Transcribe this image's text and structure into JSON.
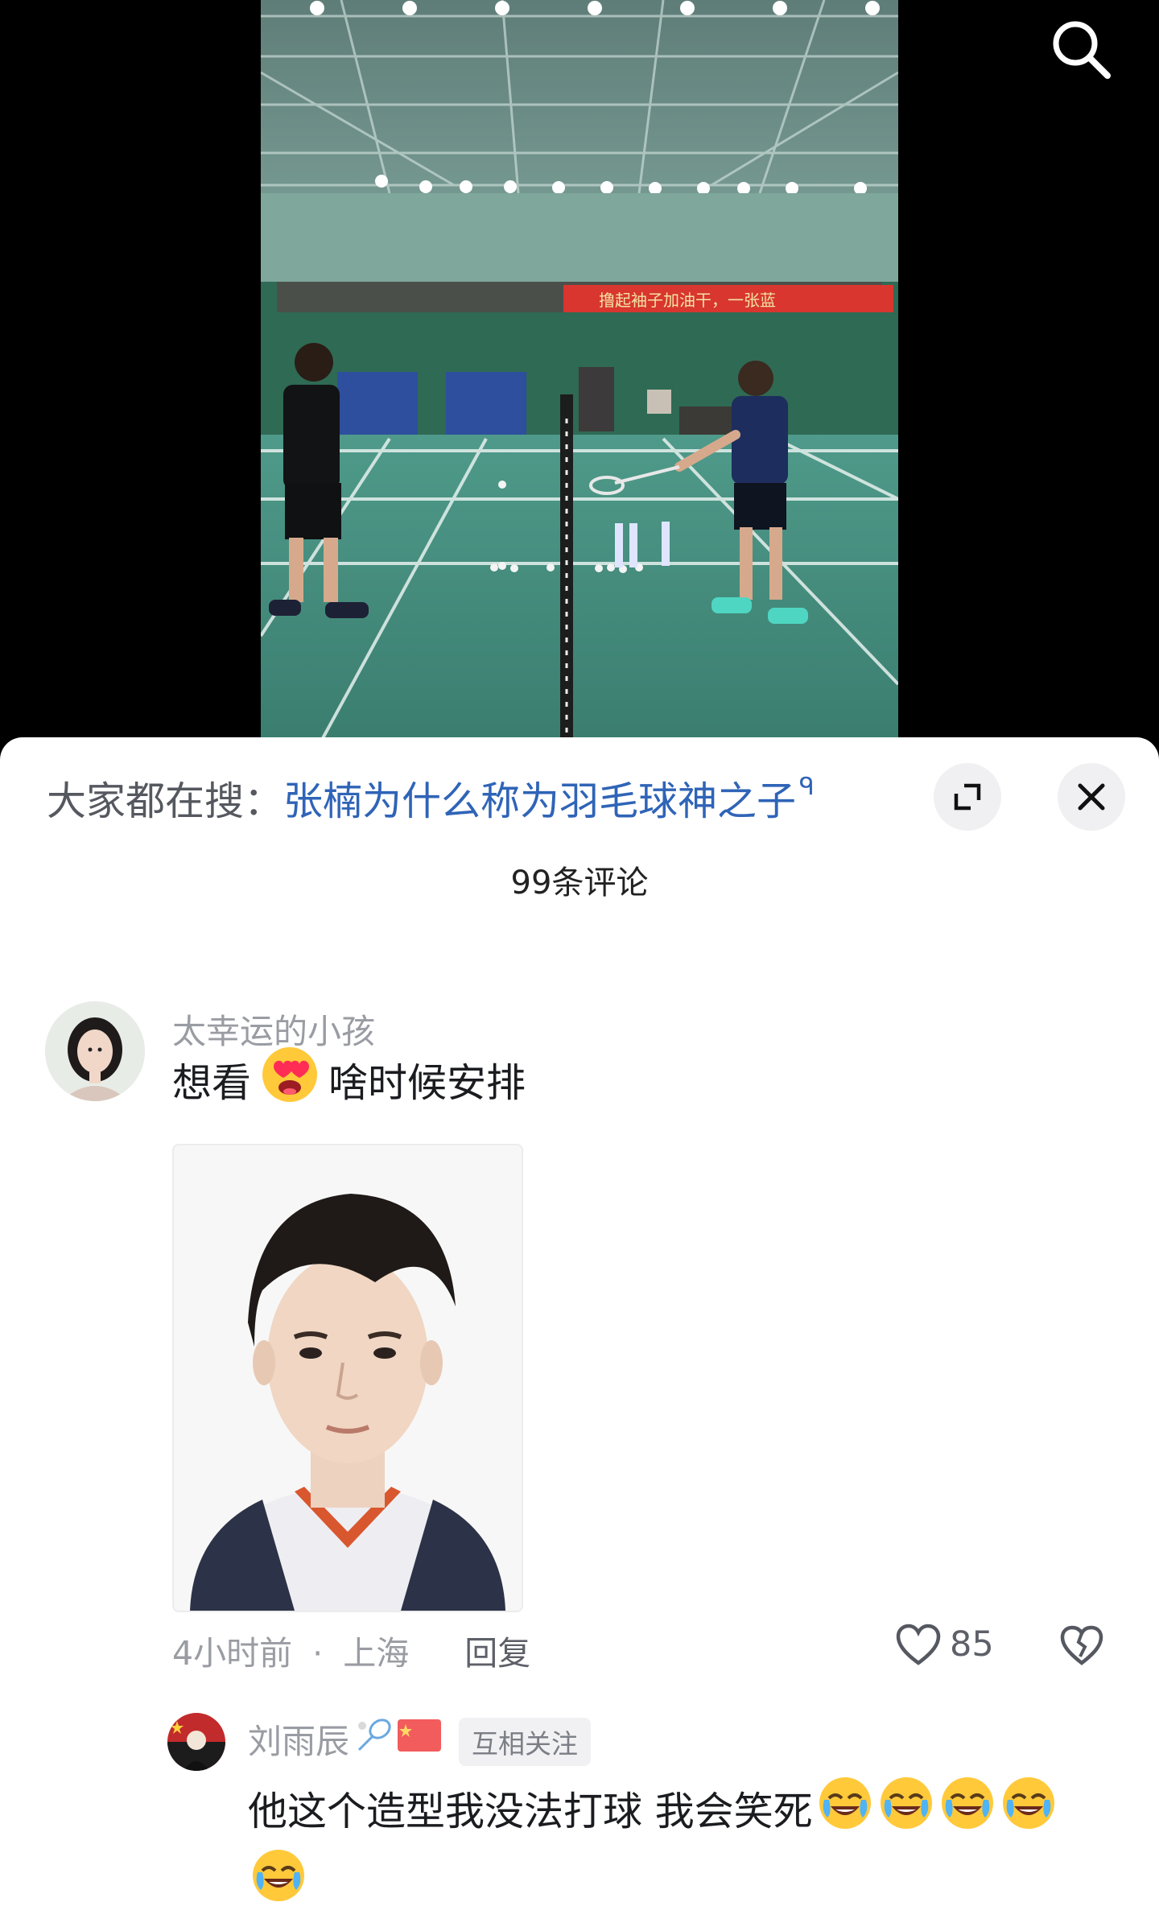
{
  "video": {
    "banner_text": "撸起袖子加油干，一张蓝"
  },
  "search": {
    "icon": "search-icon"
  },
  "sheet": {
    "hot_search_prefix": "大家都在搜：",
    "hot_search_query": "张楠为什么称为羽毛球神之子",
    "hot_search_icon": "ᑫ",
    "comment_count": "99条评论"
  },
  "comments": [
    {
      "username": "太幸运的小孩",
      "text_before": "想看",
      "emoji": "heart-eyes-emoji",
      "text_after": "啥时候安排",
      "time": "4小时前",
      "separator": "·",
      "location": "上海",
      "reply_label": "回复",
      "likes": "85"
    },
    {
      "username": "刘雨辰",
      "badges": [
        "badminton-emoji",
        "china-flag-emoji"
      ],
      "tag": "互相关注",
      "text": "他这个造型我没法打球 我会笑死",
      "emoji": "crying-laughing-emoji",
      "emoji_count": 5
    }
  ],
  "colors": {
    "link_blue": "#2f64b7",
    "muted_gray": "#9a9ca3",
    "court_green": "#3f8a7a",
    "banner_red": "#d8362f"
  }
}
